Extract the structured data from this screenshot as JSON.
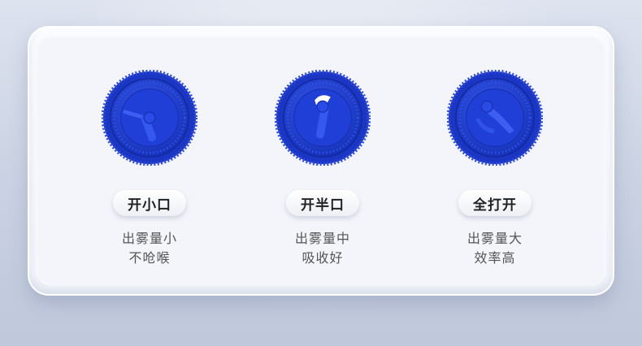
{
  "colors": {
    "knob_blue": "#1f3fd6",
    "knob_dark": "#1430b0",
    "text_dark": "#222222",
    "text_muted": "#555555"
  },
  "options": [
    {
      "label": "开小口",
      "desc_line1": "出雾量小",
      "desc_line2": "不呛喉",
      "icon": "small-opening-knob-icon"
    },
    {
      "label": "开半口",
      "desc_line1": "出雾量中",
      "desc_line2": "吸收好",
      "icon": "half-opening-knob-icon"
    },
    {
      "label": "全打开",
      "desc_line1": "出雾量大",
      "desc_line2": "效率高",
      "icon": "full-opening-knob-icon"
    }
  ]
}
